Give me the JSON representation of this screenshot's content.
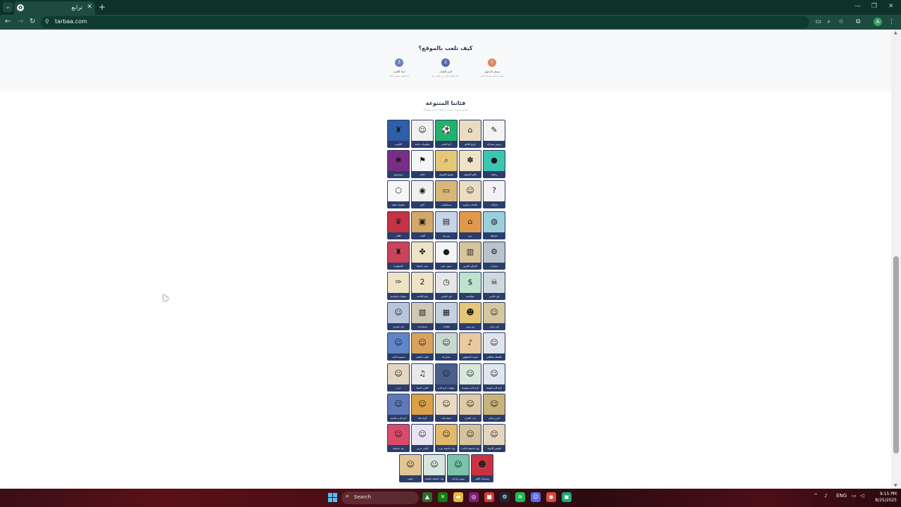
{
  "browser": {
    "tab_title": "ترابع",
    "url": "tarbaa.com",
    "profile_initial": "A"
  },
  "howto": {
    "title": "كيف تلعب بالموقع؟",
    "steps": [
      {
        "num": "1",
        "title": "سجل الدخول",
        "desc": "سجل الدخول بحسابك للبدء",
        "color": "#d98a5f"
      },
      {
        "num": "2",
        "title": "اختر الفئات",
        "desc": "اختر الفئات التي تريد اللعب بها",
        "color": "#5a68a8"
      },
      {
        "num": "3",
        "title": "ابدأ اللعب",
        "desc": "ابدأ اللعب مع أصدقائك",
        "color": "#6d83b6"
      }
    ]
  },
  "categories": {
    "title": "فئاتنا المتنوعة",
    "subtitle": "اكتشف مجموعة متنوعة من الفئات واختبر معلوماتك",
    "items": [
      {
        "label": "رسوم متحركة",
        "bg": "#f3f3f3",
        "icon": "cartoon-icon",
        "glyph": "✎"
      },
      {
        "label": "تاريخ العالم",
        "bg": "#e9dcc1",
        "icon": "history-icon",
        "glyph": "⌂"
      },
      {
        "label": "كرة القدم",
        "bg": "#21b26b",
        "icon": "football-icon",
        "glyph": "⚽"
      },
      {
        "label": "معلومات عامة",
        "bg": "#f1f1f1",
        "icon": "head-icon",
        "glyph": "☺"
      },
      {
        "label": "الكويت",
        "bg": "#2e5fa8",
        "icon": "kuwait-icon",
        "glyph": "♜"
      },
      {
        "label": "رياضة",
        "bg": "#3cc6b0",
        "icon": "sport-ball-icon",
        "glyph": "●"
      },
      {
        "label": "عالم الحيوان",
        "bg": "#efe3c6",
        "icon": "paw-icon",
        "glyph": "✽"
      },
      {
        "label": "مفتوح الحيوان",
        "bg": "#e4c878",
        "icon": "magnifier-icon",
        "glyph": "⌕"
      },
      {
        "label": "أعلام",
        "bg": "#f5f5f5",
        "icon": "flag-icon",
        "glyph": "⚑"
      },
      {
        "label": "سبيستون",
        "bg": "#7a2d86",
        "icon": "spacetoon-icon",
        "glyph": "✺"
      },
      {
        "label": "ماركات",
        "bg": "#f2f2f2",
        "icon": "question-icon",
        "glyph": "?"
      },
      {
        "label": "علامات تجارية",
        "bg": "#e9dcc1",
        "icon": "sheikh-icon",
        "glyph": "☺"
      },
      {
        "label": "مسلسلات",
        "bg": "#d6b77a",
        "icon": "tv-icon",
        "glyph": "▭"
      },
      {
        "label": "الدي",
        "bg": "#f0f0f0",
        "icon": "eye-icon",
        "glyph": "◉"
      },
      {
        "label": "شعارات فنية",
        "bg": "#f6f6f6",
        "icon": "hexagon-question-icon",
        "glyph": "⬡"
      },
      {
        "label": "جغرافيا",
        "bg": "#9ad0dc",
        "icon": "globe-icon",
        "glyph": "◍"
      },
      {
        "label": "دين",
        "bg": "#e0994a",
        "icon": "mosque-icon",
        "glyph": "⌂"
      },
      {
        "label": "من بيته",
        "bg": "#c7d3e6",
        "icon": "console-icon",
        "glyph": "▤"
      },
      {
        "label": "ألعاب",
        "bg": "#d4a86a",
        "icon": "monitor-icon",
        "glyph": "▣"
      },
      {
        "label": "أفلام",
        "bg": "#c23445",
        "icon": "cinema-icon",
        "glyph": "♛"
      },
      {
        "label": "سيارات",
        "bg": "#b8c3cc",
        "icon": "car-icon",
        "glyph": "⚙"
      },
      {
        "label": "القرآن الكريم",
        "bg": "#d7c49a",
        "icon": "quran-icon",
        "glyph": "▥"
      },
      {
        "label": "شوف عني",
        "bg": "#f4f4f4",
        "icon": "apple-icon",
        "glyph": "●"
      },
      {
        "label": "ماني الدولة",
        "bg": "#efe3c6",
        "icon": "animals-icon",
        "glyph": "✤"
      },
      {
        "label": "السعودية",
        "bg": "#c9435a",
        "icon": "tower-icon",
        "glyph": "♜"
      },
      {
        "label": "فن عالمي",
        "bg": "#cfd8dc",
        "icon": "pirate-icon",
        "glyph": "☠"
      },
      {
        "label": "عواصمة",
        "bg": "#bfe2d0",
        "icon": "money-icon",
        "glyph": "$"
      },
      {
        "label": "فن خليجي",
        "bg": "#e6e6e6",
        "icon": "clock-icon",
        "glyph": "◷"
      },
      {
        "label": "رقم اللاعب",
        "bg": "#efe3c6",
        "icon": "jersey-icon",
        "glyph": "2"
      },
      {
        "label": "مقولات إسلامية",
        "bg": "#efe3c6",
        "icon": "pen-icon",
        "glyph": "✑"
      },
      {
        "label": "فن تراثي",
        "bg": "#d6c7a0",
        "icon": "soldier-icon",
        "glyph": "☺"
      },
      {
        "label": "ون بيس",
        "bg": "#e7c777",
        "icon": "strawhat-icon",
        "glyph": "☻"
      },
      {
        "label": "طقنات",
        "bg": "#c5d2de",
        "icon": "box-icon",
        "glyph": "▦"
      },
      {
        "label": "مسجريات",
        "bg": "#cfc8b5",
        "icon": "map-icon",
        "glyph": "▧"
      },
      {
        "label": "فن مصري",
        "bg": "#b8c5da",
        "icon": "man-icon",
        "glyph": "☺"
      },
      {
        "label": "طفولة مشاهير",
        "bg": "#dfe4ea",
        "icon": "child-icon",
        "glyph": "☺"
      },
      {
        "label": "صوت المشهور",
        "bg": "#e8c9a0",
        "icon": "singer-icon",
        "glyph": "♪"
      },
      {
        "label": "مصارعة",
        "bg": "#c8d9cf",
        "icon": "wrestler-icon",
        "glyph": "☺"
      },
      {
        "label": "قلوب البشر",
        "bg": "#d8a35e",
        "icon": "heart-man-icon",
        "glyph": "☺"
      },
      {
        "label": "مسيرة لاعب",
        "bg": "#5f86c6",
        "icon": "player-icon",
        "glyph": "☺"
      },
      {
        "label": "كرة قدم كويتية",
        "bg": "#dfe6ef",
        "icon": "kuwait-football-icon",
        "glyph": "☺"
      },
      {
        "label": "كرة قدم سعودية",
        "bg": "#d8e9dc",
        "icon": "saudi-football-icon",
        "glyph": "☺"
      },
      {
        "label": "مقولات كرة قدم",
        "bg": "#4a5f8c",
        "icon": "quote-football-icon",
        "glyph": "☺"
      },
      {
        "label": "أغاني أجنبية",
        "bg": "#e9e9e9",
        "icon": "guitar-icon",
        "glyph": "♫"
      },
      {
        "label": "حزب",
        "bg": "#e3d7c3",
        "icon": "group-icon",
        "glyph": "☺"
      },
      {
        "label": "الزير سالم",
        "bg": "#c9b37a",
        "icon": "knight-icon",
        "glyph": "☺"
      },
      {
        "label": "باب الحارة",
        "bg": "#e0c9a6",
        "icon": "mustache-icon",
        "glyph": "☺"
      },
      {
        "label": "جمعة بلات",
        "bg": "#ead9c2",
        "icon": "crowd-icon",
        "glyph": "☺"
      },
      {
        "label": "كرة سلة",
        "bg": "#d9a048",
        "icon": "basketball-icon",
        "glyph": "☺"
      },
      {
        "label": "كرة قدم عالمية",
        "bg": "#5f79b8",
        "icon": "world-football-icon",
        "glyph": "☺"
      },
      {
        "label": "قصص الأنبياء",
        "bg": "#e3d6bd",
        "icon": "prophet-icon",
        "glyph": "☺"
      },
      {
        "label": "ولد حامضة أجانب",
        "bg": "#d5c29c",
        "icon": "gentleman-icon",
        "glyph": "☺"
      },
      {
        "label": "ولد حامضة عرب",
        "bg": "#e2b96c",
        "icon": "pharaoh-icon",
        "glyph": "☺"
      },
      {
        "label": "أغاني عربي",
        "bg": "#eae3f2",
        "icon": "woman-icon",
        "glyph": "☺"
      },
      {
        "label": "ولد حامضة",
        "bg": "#d94b6a",
        "icon": "girl-icon",
        "glyph": "☺"
      },
      {
        "label": "يوسفات أفلام",
        "bg": "#c9333f",
        "icon": "villain-icon",
        "glyph": "☻"
      },
      {
        "label": "سوبر ماركت",
        "bg": "#7cc2a8",
        "icon": "cart-icon",
        "glyph": "☺"
      },
      {
        "label": "ولد حامضة خليجية",
        "bg": "#d7e6dc",
        "icon": "khaleeji-icon",
        "glyph": "☺"
      },
      {
        "label": "حيثيي",
        "bg": "#e2c692",
        "icon": "old-man-icon",
        "glyph": "☺"
      }
    ]
  },
  "taskbar": {
    "search_label": "Search",
    "language": "ENG",
    "time": "9:15 PM",
    "date": "8/25/2025"
  }
}
